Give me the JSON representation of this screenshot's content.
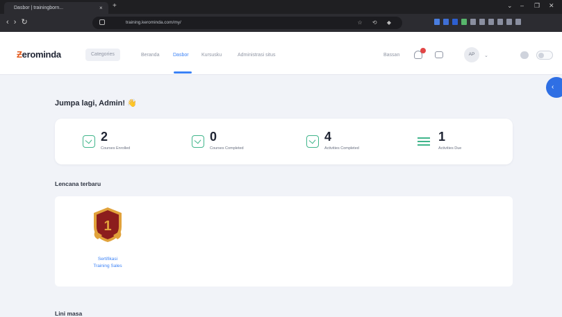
{
  "browser": {
    "tab_title": "Dasbor | trainingborn...",
    "tab_close": "×",
    "new_tab": "+",
    "window_controls": [
      "⌄",
      "–",
      "❐",
      "✕"
    ],
    "nav_arrows": "‹ › ↻",
    "url": "training.kerominda.com/my/",
    "url_icons": "☆ ⟲ ◆"
  },
  "site": {
    "logo_mark": "Ƶ",
    "logo_text": "erominda",
    "nav": {
      "categories": "Categories",
      "home": "Beranda",
      "dashboard": "Dasbor",
      "my_courses": "Kursusku",
      "site_admin": "Administrasi situs"
    },
    "language": "Bassan",
    "avatar_initials": "AP",
    "avatar_caret": "⌄"
  },
  "drawer_button": "‹",
  "greeting": {
    "text": "Jumpa lagi, Admin!",
    "emoji": "👋"
  },
  "stats": [
    {
      "value": "2",
      "label": "Courses Enrolled",
      "icon": "check-square-icon"
    },
    {
      "value": "0",
      "label": "Courses Completed",
      "icon": "checkbox-icon"
    },
    {
      "value": "4",
      "label": "Activities Completed",
      "icon": "task-check-icon"
    },
    {
      "value": "1",
      "label": "Activities Due",
      "icon": "list-lines-icon"
    }
  ],
  "recent_badges": {
    "title": "Lencana terbaru",
    "items": [
      {
        "line1": "Sertifikasi",
        "line2": "Training Sales",
        "rank": "1"
      }
    ]
  },
  "next_section": {
    "title": "Lini masa"
  },
  "colors": {
    "accent": "#3b82f6",
    "icon_green": "#3fb58a",
    "badge_red": "#8c1d1d",
    "badge_gold": "#e1a23b"
  }
}
